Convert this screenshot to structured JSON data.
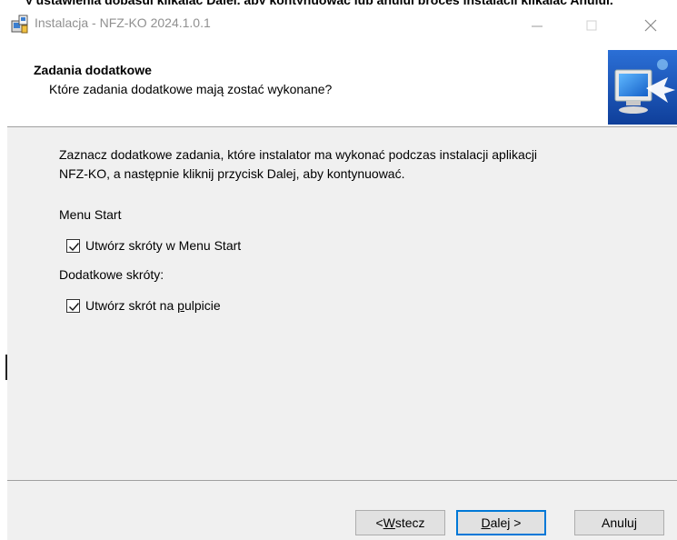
{
  "background": {
    "cut_text": "y ustawienia dopasuj klikając Dalej, aby kontynuować lub anuluj proces instalacji klikając Anuluj."
  },
  "window": {
    "title": "Instalacja - NFZ-KO 2024.1.0.1",
    "controls": {
      "minimize": "minimize-icon",
      "maximize": "maximize-icon",
      "close": "close-icon"
    }
  },
  "header": {
    "title": "Zadania dodatkowe",
    "subtitle": "Które zadania dodatkowe mają zostać wykonane?",
    "image": "computer-setup-image"
  },
  "content": {
    "intro_line1": "Zaznacz dodatkowe zadania, które instalator ma wykonać podczas instalacji aplikacji",
    "intro_line2": "NFZ-KO, a następnie kliknij przycisk Dalej, aby kontynuować.",
    "group1_label": "Menu Start",
    "task1": {
      "label": "Utwórz skróty w Menu Start",
      "checked": true
    },
    "group2_label": "Dodatkowe skróty:",
    "task2": {
      "label_prefix": "Utwórz skrót na ",
      "label_accel": "p",
      "label_suffix": "ulpicie",
      "checked": true
    }
  },
  "buttons": {
    "back": {
      "prefix": "< ",
      "accel": "W",
      "rest": "stecz"
    },
    "next": {
      "accel": "D",
      "rest": "alej >"
    },
    "cancel": "Anuluj"
  },
  "colors": {
    "accent": "#0078d7",
    "header_bg": "#ffffff",
    "body_bg": "#f0f0f0"
  }
}
